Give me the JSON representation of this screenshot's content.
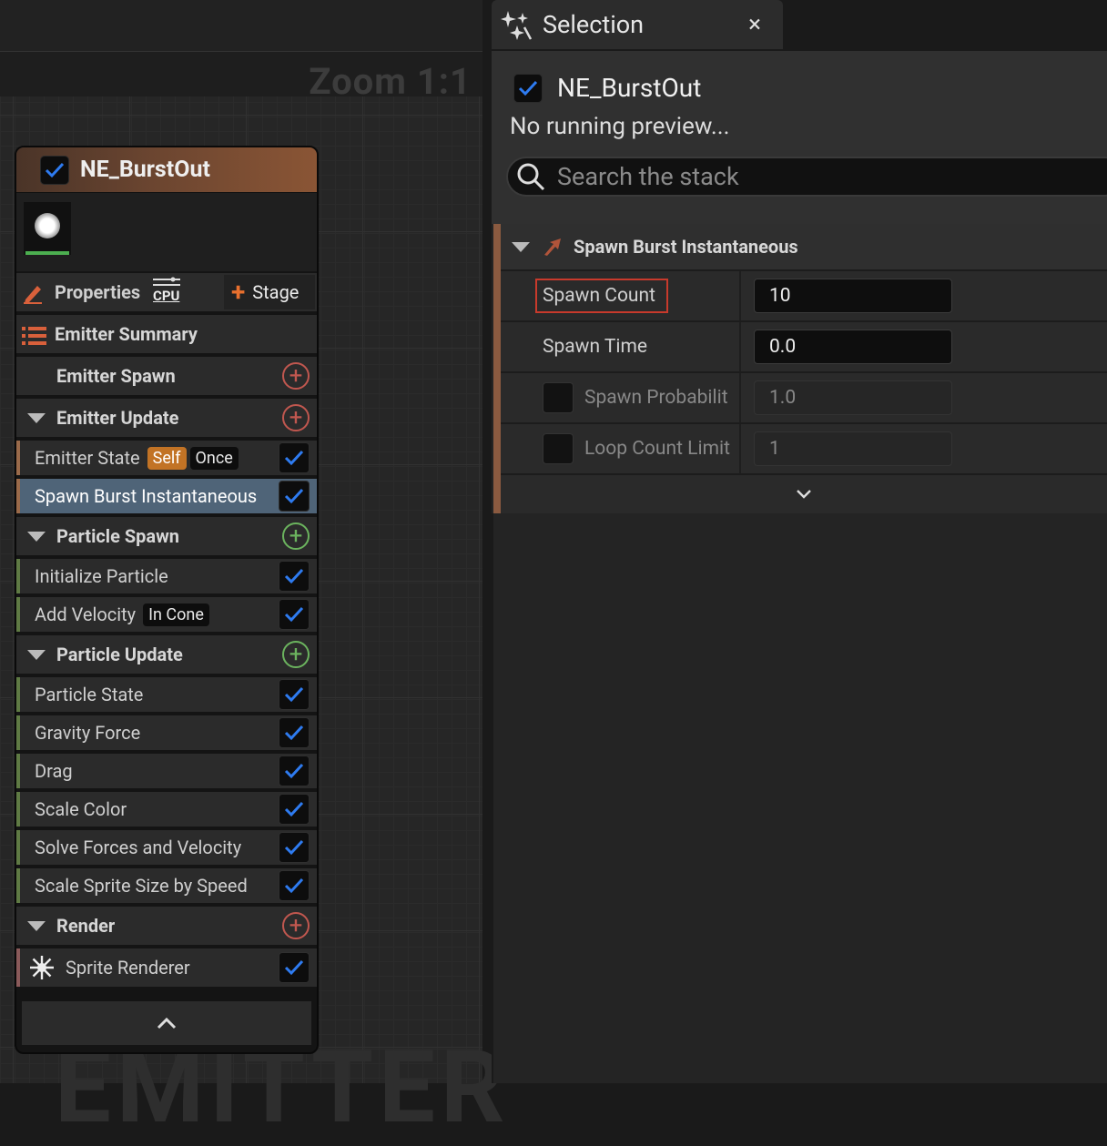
{
  "graph": {
    "zoom_label": "Zoom 1:1",
    "watermark": "EMITTER"
  },
  "node": {
    "title": "NE_BurstOut",
    "enabled": true,
    "properties_label": "Properties",
    "cpu_badge": "CPU",
    "stage_label": "Stage",
    "emitter_summary_label": "Emitter Summary",
    "sections": {
      "emitter_spawn": "Emitter Spawn",
      "emitter_update": "Emitter Update",
      "particle_spawn": "Particle Spawn",
      "particle_update": "Particle Update",
      "render": "Render"
    },
    "modules": {
      "emitter_state": {
        "label": "Emitter State",
        "tag1": "Self",
        "tag2": "Once"
      },
      "spawn_burst": {
        "label": "Spawn Burst Instantaneous"
      },
      "initialize_particle": {
        "label": "Initialize Particle"
      },
      "add_velocity": {
        "label": "Add Velocity",
        "tag": "In Cone"
      },
      "particle_state": {
        "label": "Particle State"
      },
      "gravity_force": {
        "label": "Gravity Force"
      },
      "drag": {
        "label": "Drag"
      },
      "scale_color": {
        "label": "Scale Color"
      },
      "solve_forces": {
        "label": "Solve Forces and Velocity"
      },
      "scale_sprite": {
        "label": "Scale Sprite Size by Speed"
      },
      "sprite_renderer": {
        "label": "Sprite Renderer"
      }
    }
  },
  "selection_panel": {
    "tab_title": "Selection",
    "close_label": "×",
    "emitter_name": "NE_BurstOut",
    "preview_status": "No running preview...",
    "search": {
      "placeholder": "Search the stack"
    },
    "module_title": "Spawn Burst Instantaneous",
    "params": [
      {
        "name": "Spawn Count",
        "value": "10",
        "enabled": true
      },
      {
        "name": "Spawn Time",
        "value": "0.0",
        "enabled": true
      },
      {
        "name": "Spawn Probabilit",
        "value": "1.0",
        "enabled": false
      },
      {
        "name": "Loop Count Limit",
        "value": "1",
        "enabled": false
      }
    ]
  },
  "colors": {
    "accent_orange": "#c27325",
    "check_blue": "#2e7bf0",
    "selected_row": "#4f6478",
    "highlight_red": "#c83a2c",
    "add_green": "#6bb35e",
    "add_red": "#c0574f"
  }
}
